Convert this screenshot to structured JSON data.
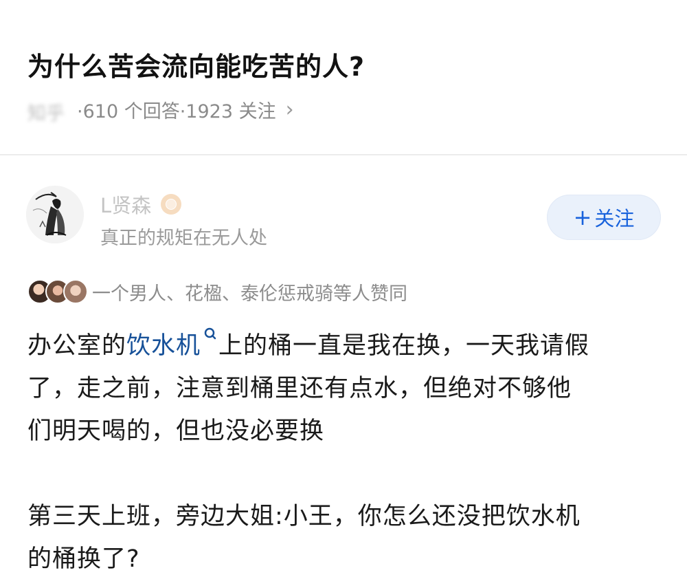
{
  "question": {
    "title": "为什么苦会流向能吃苦的人?",
    "source": "知乎",
    "stats": "·610 个回答·1923 关注",
    "chevron": "›"
  },
  "author": {
    "name": "L贤森",
    "bio": "真正的规矩在无人处",
    "avatar_icon": "ink-figure-avatar",
    "badge_icon": "badge-icon"
  },
  "follow": {
    "plus": "+",
    "label": "关注",
    "accent": "#1862dc"
  },
  "likes": {
    "text": "一个男人、花楹、泰伦惩戒骑等人赞同"
  },
  "answer": {
    "line1_pre": "办公室的",
    "line1_link": "饮水机",
    "line1_post": "上的桶一直是我在换，一天我请假",
    "line2": "了，走之前，注意到桶里还有点水，但绝对不够他",
    "line3": "们明天喝的，但也没必要换",
    "line4": "第三天上班，旁边大姐:小王，你怎么还没把饮水机",
    "line5": "的桶换了?",
    "link_color": "#175199"
  }
}
